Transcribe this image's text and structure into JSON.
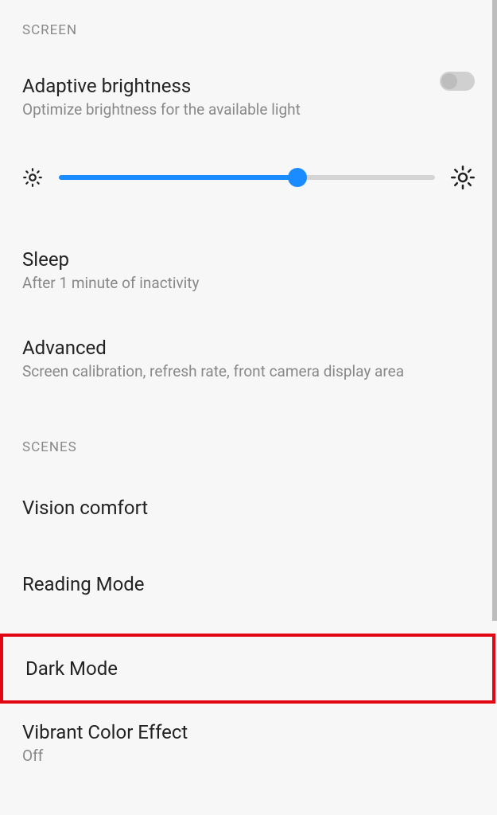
{
  "sections": {
    "screen": {
      "header": "SCREEN",
      "adaptive": {
        "title": "Adaptive brightness",
        "subtitle": "Optimize brightness for the available light",
        "toggle": false
      },
      "brightness_slider": {
        "value": 63.5
      },
      "sleep": {
        "title": "Sleep",
        "subtitle": "After 1 minute of inactivity"
      },
      "advanced": {
        "title": "Advanced",
        "subtitle": "Screen calibration, refresh rate, front camera display area"
      }
    },
    "scenes": {
      "header": "SCENES",
      "vision_comfort": {
        "title": "Vision comfort"
      },
      "reading_mode": {
        "title": "Reading Mode"
      },
      "dark_mode": {
        "title": "Dark Mode"
      },
      "vibrant": {
        "title": "Vibrant Color Effect",
        "subtitle": "Off"
      }
    }
  }
}
